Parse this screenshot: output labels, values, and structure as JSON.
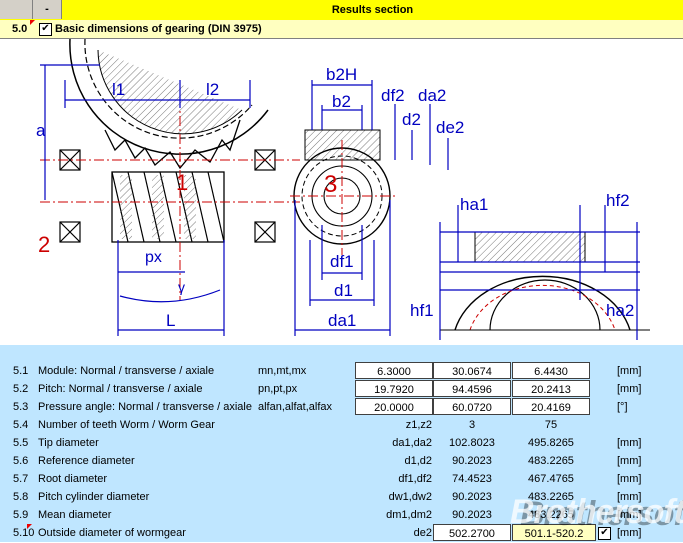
{
  "header": {
    "collapse_label": "-",
    "title": "Results section"
  },
  "section": {
    "number": "5.0",
    "checked_mark": "✔",
    "label": "Basic dimensions of gearing (DIN 3975)"
  },
  "drawing": {
    "labels": {
      "l1": "l1",
      "l2": "l2",
      "a": "a",
      "one": "1",
      "two": "2",
      "three": "3",
      "px": "px",
      "gamma": "γ",
      "L": "L",
      "b2H": "b2H",
      "b2": "b2",
      "df2": "df2",
      "da2": "da2",
      "d2": "d2",
      "de2": "de2",
      "df1": "df1",
      "d1": "d1",
      "da1": "da1",
      "ha1": "ha1",
      "hf2": "hf2",
      "hf1": "hf1",
      "ha2": "ha2"
    }
  },
  "rows": [
    {
      "num": "5.1",
      "label": "Module: Normal / transverse / axiale",
      "sym": "mn,mt,mx",
      "v1": "6.3000",
      "v2": "30.0674",
      "v3": "6.4430",
      "unit": "[mm]"
    },
    {
      "num": "5.2",
      "label": "Pitch: Normal / transverse / axiale",
      "sym": "pn,pt,px",
      "v1": "19.7920",
      "v2": "94.4596",
      "v3": "20.2413",
      "unit": "[mm]"
    },
    {
      "num": "5.3",
      "label": "Pressure angle: Normal / transverse / axiale",
      "sym": "alfan,alfat,alfax",
      "v1": "20.0000",
      "v2": "60.0720",
      "v3": "20.4169",
      "unit": "[°]"
    },
    {
      "num": "5.4",
      "label": "Number of teeth Worm /  Worm Gear",
      "sym": "z1,z2",
      "v1": "",
      "v2": "3",
      "v3": "75",
      "unit": ""
    },
    {
      "num": "5.5",
      "label": "Tip diameter",
      "sym": "da1,da2",
      "v1": "",
      "v2": "102.8023",
      "v3": "495.8265",
      "unit": "[mm]"
    },
    {
      "num": "5.6",
      "label": "Reference diameter",
      "sym": "d1,d2",
      "v1": "",
      "v2": "90.2023",
      "v3": "483.2265",
      "unit": "[mm]"
    },
    {
      "num": "5.7",
      "label": "Root diameter",
      "sym": "df1,df2",
      "v1": "",
      "v2": "74.4523",
      "v3": "467.4765",
      "unit": "[mm]"
    },
    {
      "num": "5.8",
      "label": "Pitch cylinder diameter",
      "sym": "dw1,dw2",
      "v1": "",
      "v2": "90.2023",
      "v3": "483.2265",
      "unit": "[mm]"
    },
    {
      "num": "5.9",
      "label": "Mean diameter",
      "sym": "dm1,dm2",
      "v1": "",
      "v2": "90.2023",
      "v3": "483.2265",
      "unit": "[mm]"
    },
    {
      "num": "5.10",
      "label": "Outside diameter of wormgear",
      "sym": "de2",
      "v1": "",
      "v2": "502.2700",
      "v3": "501.1-520.2",
      "unit": "[mm]",
      "checked": "✔"
    }
  ],
  "watermark": "Brothersoft"
}
